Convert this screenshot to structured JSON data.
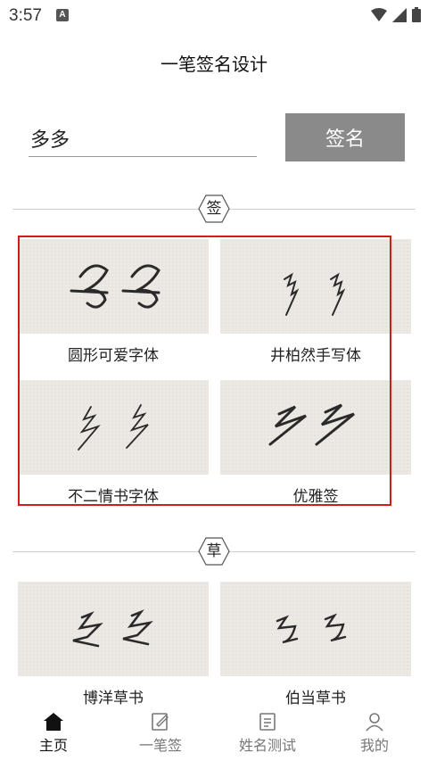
{
  "status_bar": {
    "time": "3:57",
    "notification_icon": "a-icon"
  },
  "header": {
    "title": "一笔签名设计"
  },
  "form": {
    "name_value": "多多",
    "sign_button": "签名"
  },
  "sections": [
    {
      "label": "签",
      "cards": [
        {
          "label": "圆形可爱字体"
        },
        {
          "label": "井柏然手写体"
        },
        {
          "label": "不二情书字体"
        },
        {
          "label": "优雅签"
        }
      ]
    },
    {
      "label": "草",
      "cards": [
        {
          "label": "博洋草书"
        },
        {
          "label": "伯当草书"
        }
      ]
    }
  ],
  "bottom_nav": [
    {
      "label": "主页",
      "icon": "home-icon",
      "active": true
    },
    {
      "label": "一笔签",
      "icon": "signature-icon",
      "active": false
    },
    {
      "label": "姓名测试",
      "icon": "document-icon",
      "active": false
    },
    {
      "label": "我的",
      "icon": "person-icon",
      "active": false
    }
  ],
  "colors": {
    "highlight": "#d01c1c",
    "button": "#8a8a8a",
    "card_bg": "#ece9e4"
  }
}
